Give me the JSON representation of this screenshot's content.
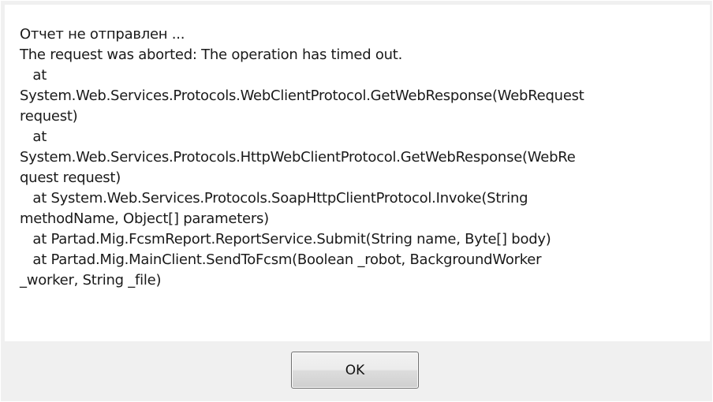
{
  "dialog": {
    "message_lines": [
      "Отчет не отправлен ...",
      "The request was aborted: The operation has timed out.",
      "   at",
      "System.Web.Services.Protocols.WebClientProtocol.GetWebResponse(WebRequest",
      "request)",
      "   at",
      "System.Web.Services.Protocols.HttpWebClientProtocol.GetWebResponse(WebRe",
      "quest request)",
      "   at System.Web.Services.Protocols.SoapHttpClientProtocol.Invoke(String",
      "methodName, Object[] parameters)",
      "   at Partad.Mig.FcsmReport.ReportService.Submit(String name, Byte[] body)",
      "   at Partad.Mig.MainClient.SendToFcsm(Boolean _robot, BackgroundWorker",
      "_worker, String _file)"
    ],
    "ok_label": "OK"
  }
}
